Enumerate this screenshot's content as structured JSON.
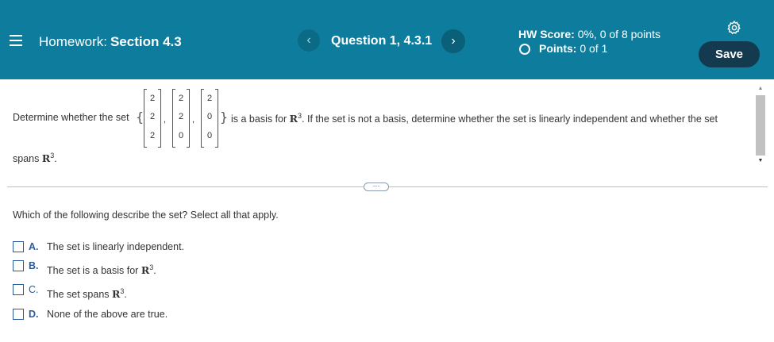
{
  "header": {
    "hw_prefix": "Homework:",
    "hw_section": "Section 4.3",
    "question_label": "Question 1, 4.3.1",
    "prev_label": "‹",
    "next_label": "›",
    "hw_score_label": "HW Score:",
    "hw_score_value": "0%, 0 of 8 points",
    "points_label": "Points:",
    "points_value": "0 of 1",
    "save_label": "Save"
  },
  "question": {
    "prompt_start": "Determine whether the set",
    "prompt_mid": "is a basis for",
    "prompt_end": ". If the set is not a basis, determine whether the set is linearly independent and whether the set",
    "prompt_line2": "spans",
    "r_symbol": "R",
    "exponent": "3",
    "vectors": [
      [
        "2",
        "2",
        "2"
      ],
      [
        "2",
        "2",
        "0"
      ],
      [
        "2",
        "0",
        "0"
      ]
    ],
    "instruction": "Which of the following describe the set? Select all that apply."
  },
  "choices": [
    {
      "letter": "A.",
      "text": "The set is linearly independent."
    },
    {
      "letter": "B.",
      "text": "The set is a basis for"
    },
    {
      "letter": "C.",
      "text": "The set spans"
    },
    {
      "letter": "D.",
      "text": "None of the above are true."
    }
  ],
  "expander_label": "⋯",
  "colors": {
    "header_bg": "#0e7c9c",
    "save_bg": "#133a4f",
    "choice_accent": "#2a5a9a"
  }
}
